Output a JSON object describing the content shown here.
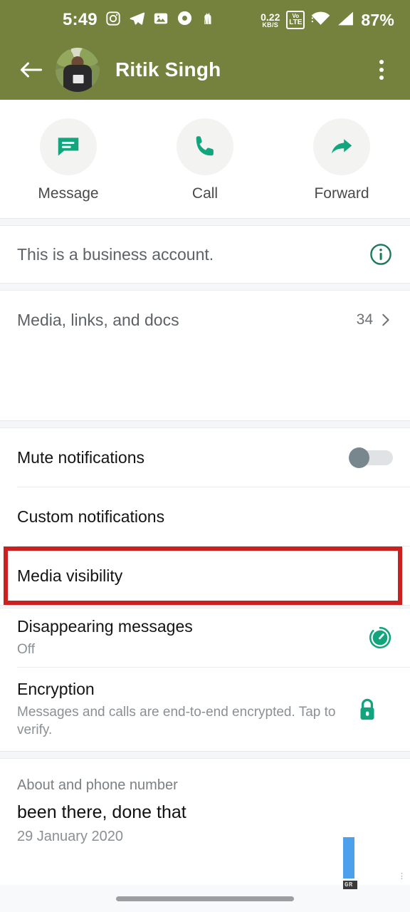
{
  "statusbar": {
    "time": "5:49",
    "app_icons": [
      "instagram-icon",
      "telegram-icon",
      "gallery-icon",
      "music-ring-icon",
      "app-icon"
    ],
    "data_rate_value": "0.22",
    "data_rate_unit": "KB/S",
    "network_type_top": "Vo",
    "network_type_bottom": "LTE",
    "wifi": "wifi-icon",
    "signal": "signal-icon",
    "battery": "87%"
  },
  "appbar": {
    "back": "back-arrow-icon",
    "avatar": "contact-avatar",
    "contact_name": "Ritik Singh",
    "overflow": "more-options-icon"
  },
  "actions": [
    {
      "icon": "message-icon",
      "label": "Message"
    },
    {
      "icon": "call-icon",
      "label": "Call"
    },
    {
      "icon": "forward-icon",
      "label": "Forward"
    }
  ],
  "business": {
    "label": "This is a business account.",
    "icon": "info-icon"
  },
  "media": {
    "label": "Media, links, and docs",
    "count": "34",
    "chevron": "chevron-right-icon"
  },
  "settings": [
    {
      "title": "Mute notifications",
      "control": "toggle",
      "toggle_on": false
    },
    {
      "title": "Custom notifications",
      "control": "none"
    },
    {
      "title": "Media visibility",
      "control": "none",
      "highlighted": true
    }
  ],
  "privacy": [
    {
      "title": "Disappearing messages",
      "subtitle": "Off",
      "icon": "timer-icon"
    },
    {
      "title": "Encryption",
      "subtitle": "Messages and calls are end-to-end encrypted. Tap to verify.",
      "icon": "lock-icon"
    }
  ],
  "about": {
    "label": "About and phone number",
    "status_text": "been there, done that",
    "date": "29 January 2020"
  },
  "watermark": {
    "text": "GR"
  },
  "colors": {
    "header_green": "#75823E",
    "accent_green": "#12A57D",
    "highlight_red": "#CC1F1F",
    "watermark_blue": "#4DA0EC"
  }
}
